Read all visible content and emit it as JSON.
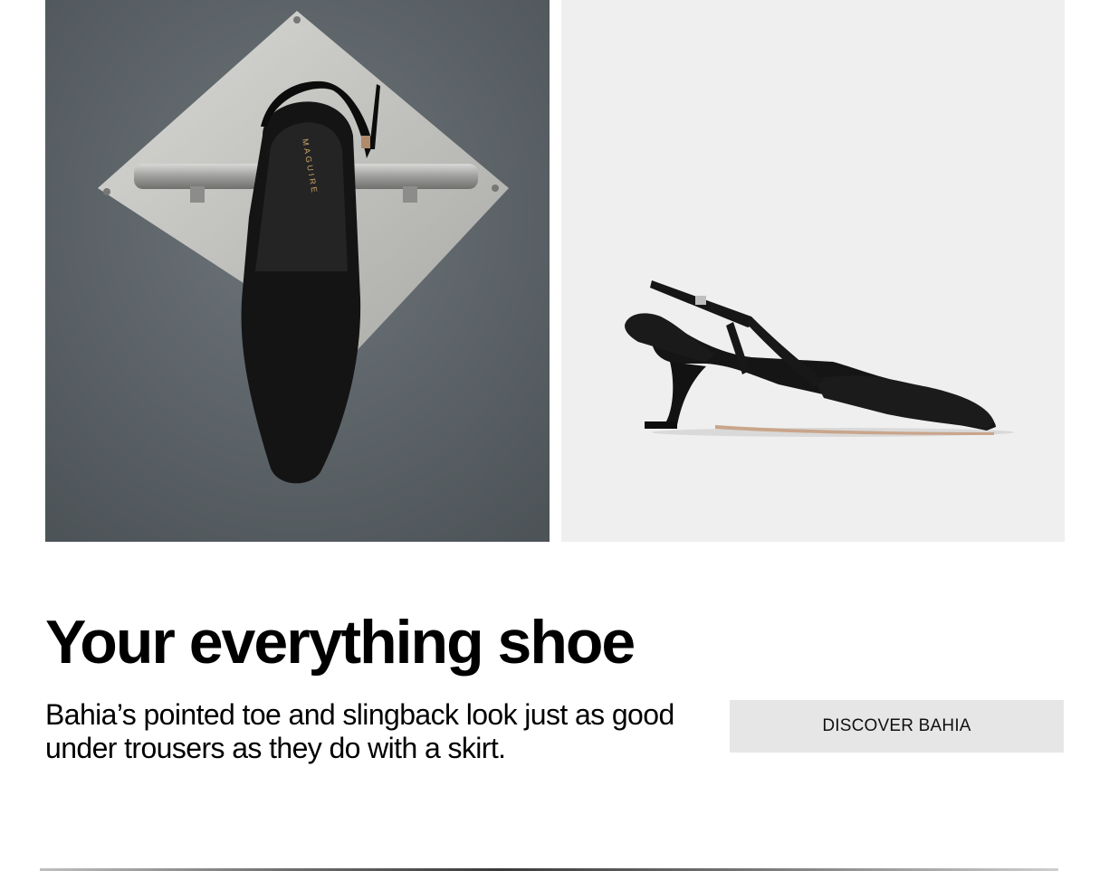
{
  "hero": {
    "left_image_alt": "Black slingback shoe hung on a metal handle",
    "left_image_brand_imprint": "MAGUIRE",
    "right_image_alt": "Black pointed-toe slingback heel side view"
  },
  "content": {
    "headline": "Your everything shoe",
    "description": "Bahia’s pointed toe and slingback look just as good under trousers as they do with a skirt.",
    "cta_label": "DISCOVER BAHIA"
  },
  "colors": {
    "cta_background": "#e6e6e6",
    "text": "#000000",
    "wall": "#5f666b",
    "studio_background": "#efefef"
  }
}
